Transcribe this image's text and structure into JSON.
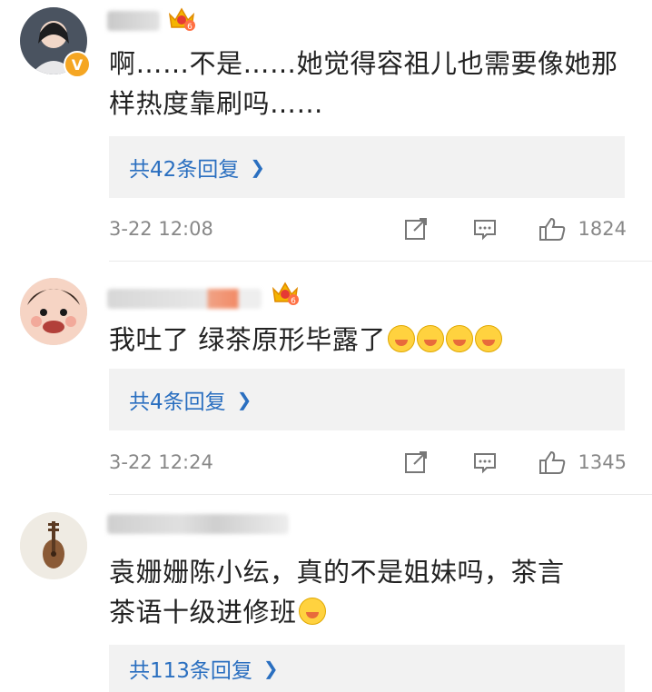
{
  "comments": [
    {
      "text_line1": "啊……不是……她觉得容祖儿也需要像她那",
      "text_line2": "样热度靠刷吗……",
      "reply_label": "共42条回复",
      "time": "3-22 12:08",
      "likes": "1824",
      "verified": true,
      "level_badge": "6"
    },
    {
      "text_line1": "我吐了 绿茶原形毕露了",
      "text_line2": "",
      "reply_label": "共4条回复",
      "time": "3-22 12:24",
      "likes": "1345",
      "verified": false,
      "level_badge": "6"
    },
    {
      "text_line1": "袁姗姗陈小纭，真的不是姐妹吗，茶言",
      "text_line2": "茶语十级进修班",
      "reply_label": "共113条回复",
      "time": "",
      "likes": "",
      "verified": false
    }
  ],
  "icons": {
    "reply_chevron": "chevron-right-icon",
    "share": "share-icon",
    "comment": "comment-icon",
    "like": "thumbs-up-icon"
  },
  "colors": {
    "link": "#2a6fc0",
    "meta": "#888888",
    "reply_bg": "#f2f2f2",
    "verified": "#f5a623"
  }
}
